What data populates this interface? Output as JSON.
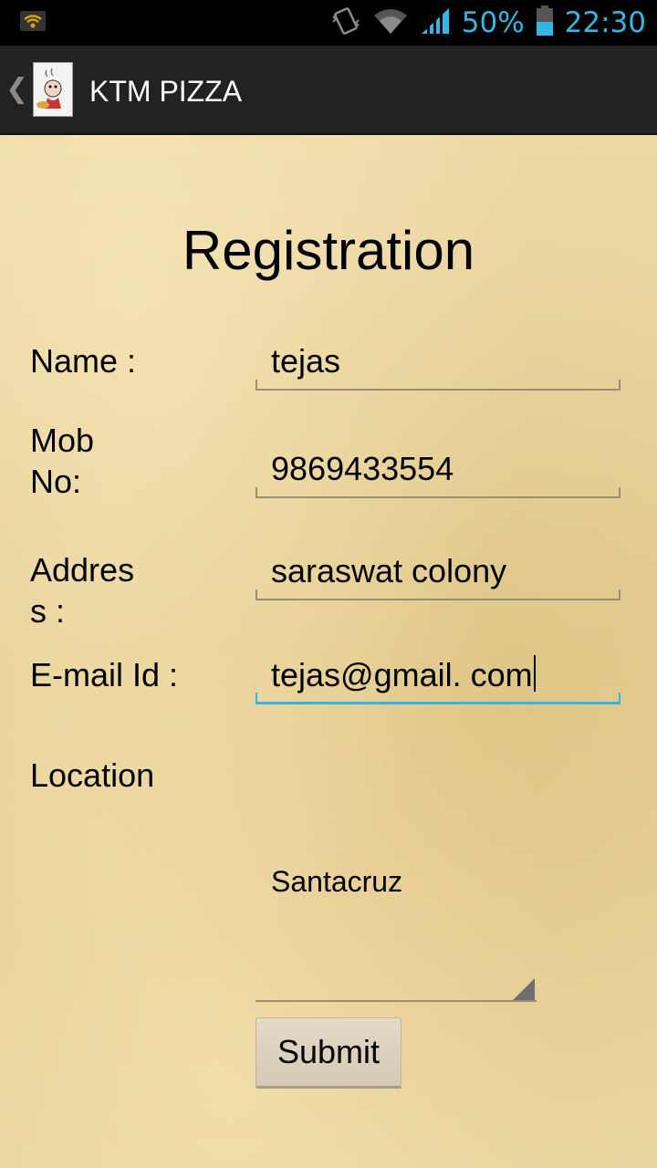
{
  "status_bar": {
    "battery_percent": "50%",
    "time": "22:30",
    "icons": [
      "wifi-notification-icon",
      "vibrate-icon",
      "wifi-icon",
      "signal-icon",
      "battery-icon"
    ],
    "accent_color": "#33b5e5"
  },
  "action_bar": {
    "title": "KTM PIZZA",
    "icons": [
      "back-chevron-icon",
      "app-logo-icon"
    ]
  },
  "form": {
    "heading": "Registration",
    "name_label": "Name :",
    "name_value": "tejas",
    "mob_label_line1": "Mob",
    "mob_label_line2": "No:",
    "mob_value": "9869433554",
    "address_label_line1": "Addres",
    "address_label_line2": "s :",
    "address_value": "saraswat colony",
    "email_label": "E-mail Id :",
    "email_value": "tejas@gmail. com",
    "location_label": "Location",
    "location_value": "Santacruz",
    "submit_label": "Submit",
    "focus_color": "#33b5e5"
  }
}
